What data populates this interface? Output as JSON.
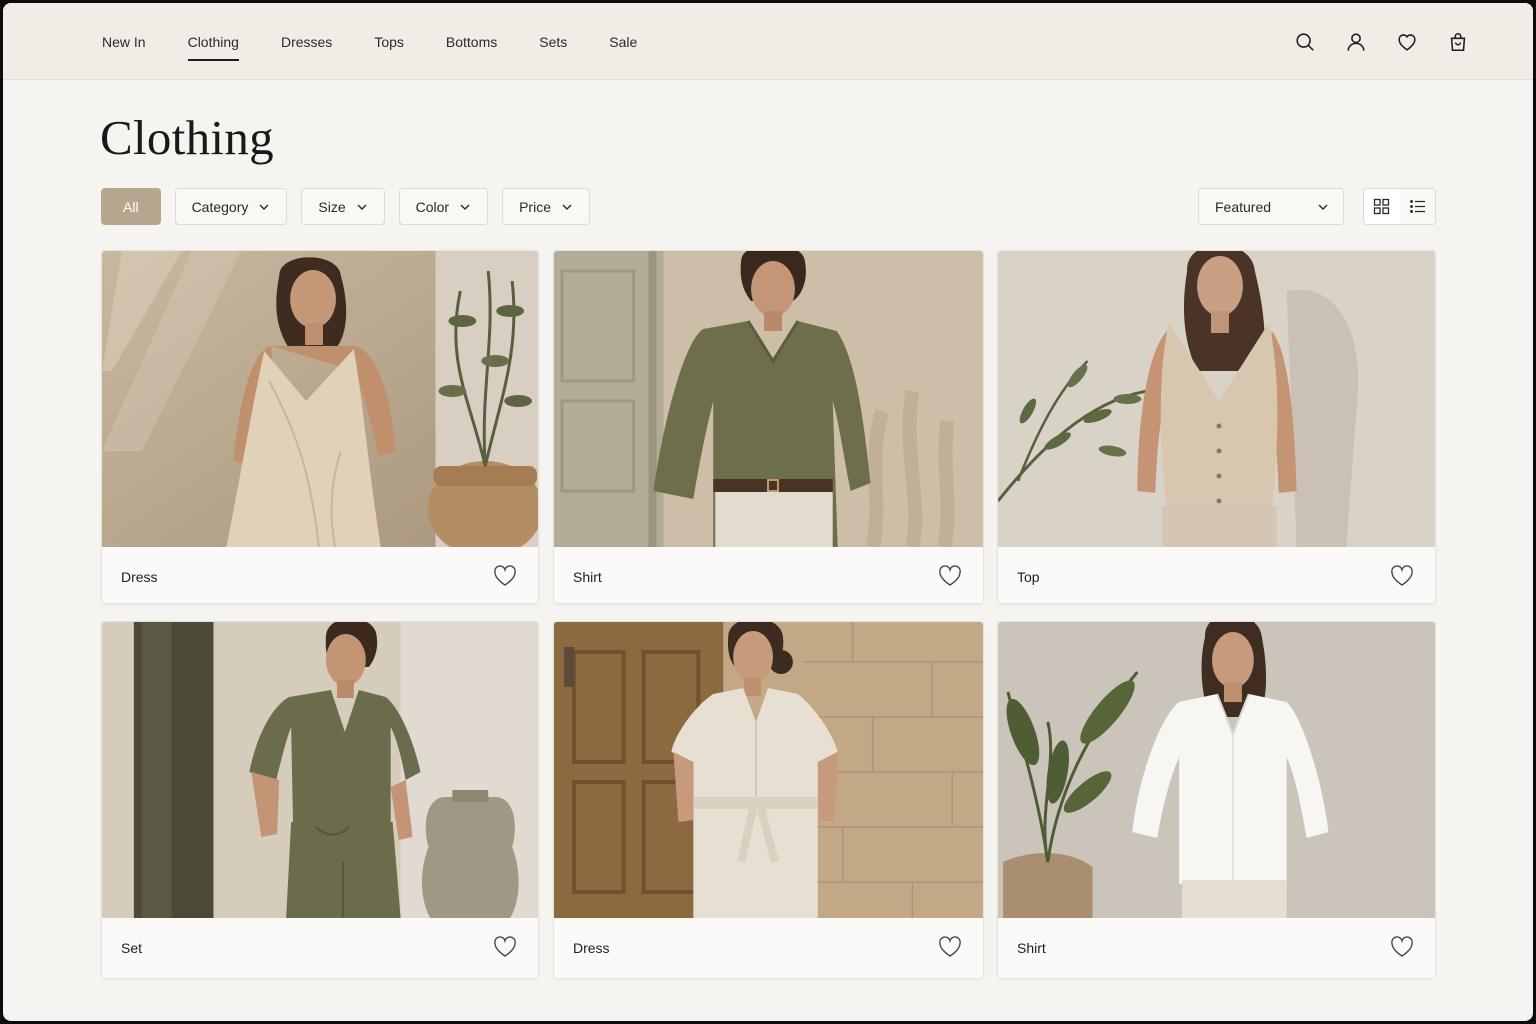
{
  "nav": {
    "items": [
      {
        "label": "New In"
      },
      {
        "label": "Clothing",
        "active": true
      },
      {
        "label": "Dresses"
      },
      {
        "label": "Tops"
      },
      {
        "label": "Bottoms"
      },
      {
        "label": "Sets"
      },
      {
        "label": "Sale"
      }
    ],
    "icons": [
      "search-icon",
      "account-icon",
      "wishlist-heart-icon",
      "shopping-bag-icon"
    ]
  },
  "page": {
    "title": "Clothing"
  },
  "filters": {
    "all_label": "All",
    "dropdowns": [
      {
        "label": "Category"
      },
      {
        "label": "Size"
      },
      {
        "label": "Color"
      },
      {
        "label": "Price"
      }
    ]
  },
  "sort": {
    "selected": "Featured"
  },
  "view_toggle": {
    "active": "grid",
    "options": [
      "grid-view-icon",
      "list-view-icon"
    ]
  },
  "colors": {
    "accent": "#b7a68e",
    "background": "#f6f4f0",
    "header": "#f1ede6",
    "text": "#1c1c1a"
  },
  "products": [
    {
      "label": "Dress",
      "garment": "beige linen wrap slip dress"
    },
    {
      "label": "Shirt",
      "garment": "olive green linen shirt"
    },
    {
      "label": "Top",
      "garment": "beige linen vest"
    },
    {
      "label": "Set",
      "garment": "olive linen shirt and trousers set"
    },
    {
      "label": "Dress",
      "garment": "cream linen belted shirt dress"
    },
    {
      "label": "Shirt",
      "garment": "white linen shirt"
    }
  ]
}
